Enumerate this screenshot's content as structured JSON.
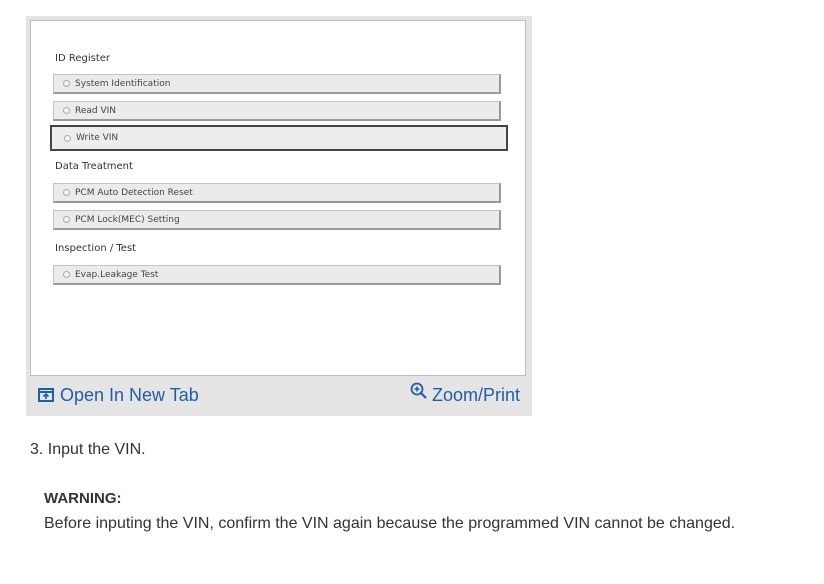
{
  "screenshot": {
    "sections": [
      {
        "title": "ID Register",
        "items": [
          "System Identification",
          "Read VIN",
          "Write VIN"
        ]
      },
      {
        "title": "Data Treatment",
        "items": [
          "PCM Auto Detection Reset",
          "PCM Lock(MEC) Setting"
        ]
      },
      {
        "title": "Inspection / Test",
        "items": [
          "Evap.Leakage Test"
        ]
      }
    ],
    "selected_item": "Write VIN"
  },
  "toolbar": {
    "open_new_tab_label": "Open In New Tab",
    "zoom_print_label": "Zoom/Print",
    "link_color": "#1f5ea8"
  },
  "instructions": {
    "step": "3. Input the VIN.",
    "warning_title": "WARNING:",
    "warning_body": "Before inputing the VIN, confirm the VIN again because the programmed VIN cannot be changed."
  }
}
